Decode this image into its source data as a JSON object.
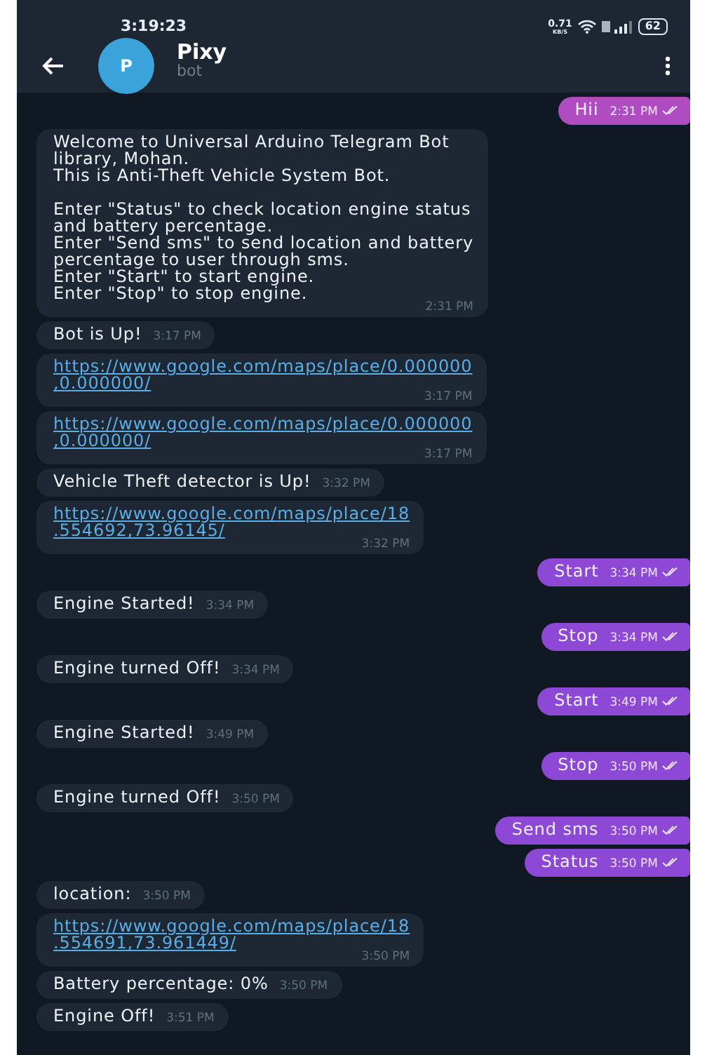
{
  "status_bar": {
    "time": "3:19:23",
    "net_speed": "0.71",
    "net_unit": "KB/S",
    "battery": "62"
  },
  "header": {
    "avatar_letter": "P",
    "name": "Pixy",
    "subtitle": "bot"
  },
  "messages": [
    {
      "kind": "out",
      "text": "Hii",
      "time": "2:31 PM",
      "color": "#b04cc2"
    },
    {
      "kind": "in",
      "text": "Welcome to Universal Arduino Telegram Bot\nlibrary, Mohan.\nThis is Anti-Theft Vehicle System Bot.\n\nEnter \"Status\" to check location engine status\nand battery percentage.\nEnter \"Send sms\" to send location and battery\npercentage to user through sms.\nEnter \"Start\" to start engine.\nEnter \"Stop\" to stop engine.",
      "time": "2:31 PM"
    },
    {
      "kind": "in",
      "text": "Bot is Up!",
      "time": "3:17 PM"
    },
    {
      "kind": "link",
      "text": "https://www.google.com/maps/place/0.000000\n,0.000000/",
      "time": "3:17 PM"
    },
    {
      "kind": "link",
      "text": "https://www.google.com/maps/place/0.000000\n,0.000000/",
      "time": "3:17 PM"
    },
    {
      "kind": "in",
      "text": "Vehicle Theft detector is Up!",
      "time": "3:32 PM"
    },
    {
      "kind": "link",
      "text": "https://www.google.com/maps/place/18\n.554692,73.96145/",
      "time": "3:32 PM"
    },
    {
      "kind": "out",
      "text": "Start",
      "time": "3:34 PM",
      "color": "#8d49d6"
    },
    {
      "kind": "in",
      "text": "Engine Started!",
      "time": "3:34 PM"
    },
    {
      "kind": "out",
      "text": "Stop",
      "time": "3:34 PM",
      "color": "#8d49d6"
    },
    {
      "kind": "in",
      "text": "Engine turned Off!",
      "time": "3:34 PM"
    },
    {
      "kind": "out",
      "text": "Start",
      "time": "3:49 PM",
      "color": "#8d49d6"
    },
    {
      "kind": "in",
      "text": "Engine Started!",
      "time": "3:49 PM"
    },
    {
      "kind": "out",
      "text": "Stop",
      "time": "3:50 PM",
      "color": "#8d49d6"
    },
    {
      "kind": "in",
      "text": "Engine turned Off!",
      "time": "3:50 PM"
    },
    {
      "kind": "out",
      "text": "Send sms",
      "time": "3:50 PM",
      "color": "#8d49d6"
    },
    {
      "kind": "out",
      "text": "Status",
      "time": "3:50 PM",
      "color": "#8d49d6"
    },
    {
      "kind": "in",
      "text": "location:",
      "time": "3:50 PM"
    },
    {
      "kind": "link",
      "text": "https://www.google.com/maps/place/18\n.554691,73.961449/",
      "time": "3:50 PM"
    },
    {
      "kind": "in",
      "text": "Battery percentage: 0%",
      "time": "3:50 PM"
    },
    {
      "kind": "in",
      "text": "Engine Off!",
      "time": "3:51 PM"
    }
  ]
}
